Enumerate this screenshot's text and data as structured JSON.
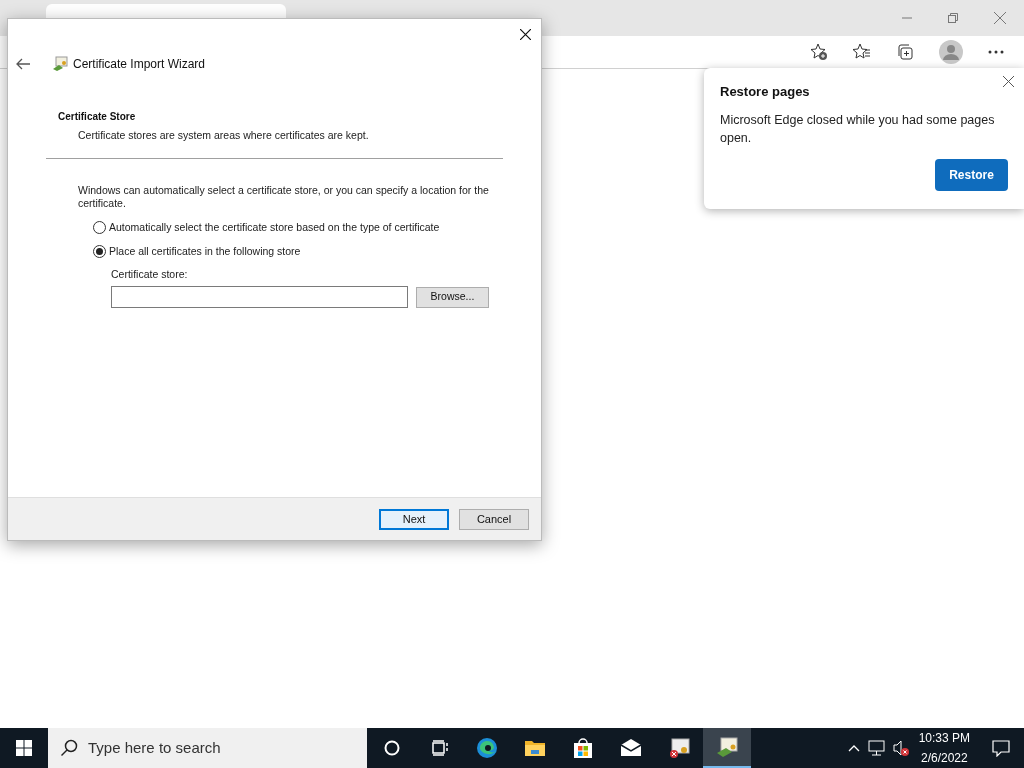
{
  "dialog": {
    "title": "Certificate Import Wizard",
    "section_title": "Certificate Store",
    "section_subtitle": "Certificate stores are system areas where certificates are kept.",
    "intro": "Windows can automatically select a certificate store, or you can specify a location for the certificate.",
    "options": [
      {
        "label": "Automatically select the certificate store based on the type of certificate",
        "selected": false
      },
      {
        "label": "Place all certificates in the following store",
        "selected": true
      }
    ],
    "store_label": "Certificate store:",
    "browse_button": "Browse...",
    "buttons": [
      {
        "label": "Next",
        "default": true
      },
      {
        "label": "Cancel",
        "default": false
      }
    ]
  },
  "popup": {
    "title": "Restore pages",
    "message": "Microsoft Edge closed while you had some pages open.",
    "button": "Restore"
  },
  "taskbar": {
    "search_placeholder": "Type here to search",
    "apps": [
      {
        "kind": "edge",
        "active": false
      },
      {
        "kind": "folder",
        "active": false
      },
      {
        "kind": "store",
        "active": false
      },
      {
        "kind": "mail",
        "active": false
      },
      {
        "kind": "cert",
        "active": false
      },
      {
        "kind": "wizard",
        "active": true
      }
    ],
    "time": "10:33 PM",
    "date": "2/6/2022"
  }
}
